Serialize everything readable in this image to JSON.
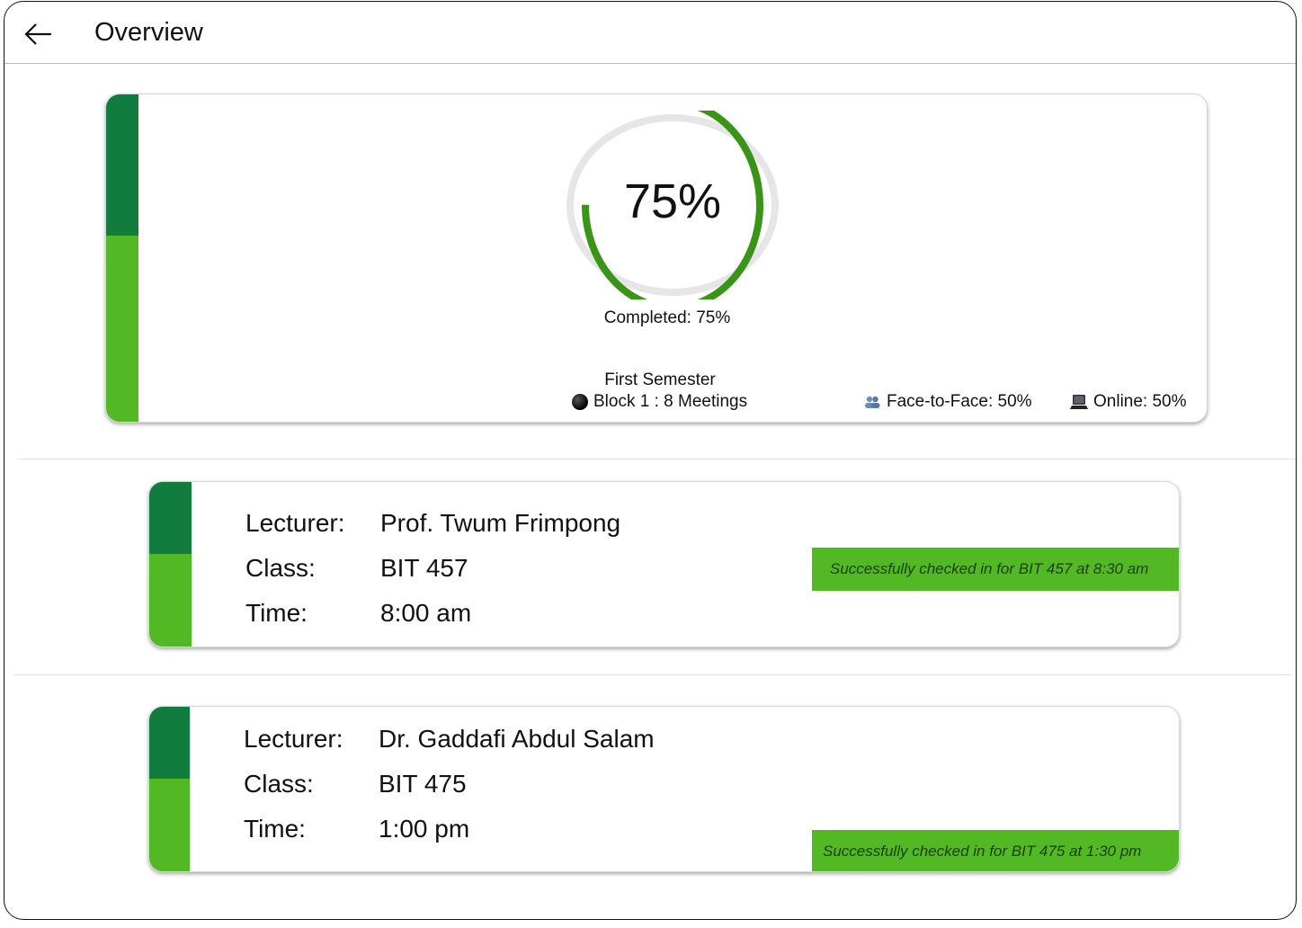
{
  "header": {
    "back_icon": "back-arrow-icon",
    "title": "Overview"
  },
  "colors": {
    "dark_green": "#127b3e",
    "light_green": "#52b925",
    "ring_green": "#3a9418",
    "ring_track": "#e6e6e6"
  },
  "summary": {
    "progress_percent": 75,
    "progress_text": "75%",
    "completed_label": "Completed: 75%",
    "semester": "First Semester",
    "block_icon": "black-circle-icon",
    "block_text": "Block 1 : 8 Meetings",
    "face_icon": "people-icon",
    "face_text": "Face-to-Face: 50%",
    "online_icon": "laptop-icon",
    "online_text": "Online: 50%"
  },
  "classes": [
    {
      "lecturer_label": "Lecturer:",
      "lecturer": "Prof. Twum Frimpong",
      "class_label": "Class:",
      "class_code": "BIT 457",
      "time_label": "Time:",
      "time": "8:00 am",
      "status": "Successfully checked in for BIT 457 at 8:30 am"
    },
    {
      "lecturer_label": "Lecturer:",
      "lecturer": "Dr. Gaddafi Abdul Salam",
      "class_label": "Class:",
      "class_code": "BIT 475",
      "time_label": "Time:",
      "time": "1:00 pm",
      "status": "Successfully checked in for BIT 475 at 1:30 pm"
    }
  ]
}
